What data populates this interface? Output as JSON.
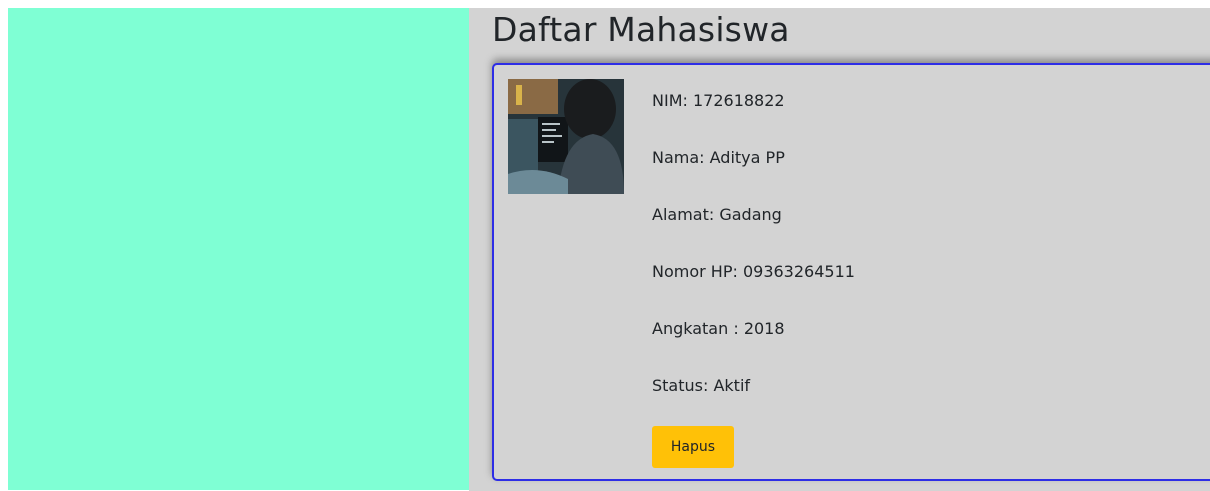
{
  "page": {
    "title": "Daftar Mahasiswa"
  },
  "student": {
    "nim_label": "NIM: 172618822",
    "nama_label": "Nama: Aditya PP",
    "alamat_label": "Alamat: Gadang",
    "hp_label": "Nomor HP: 09363264511",
    "angkatan_label": "Angkatan : 2018",
    "status_label": "Status: Aktif",
    "delete_label": "Hapus"
  },
  "colors": {
    "sidebar": "#7fffd4",
    "main_background": "#d3d3d3",
    "card_border": "#2d2de6",
    "button": "#ffc107"
  }
}
